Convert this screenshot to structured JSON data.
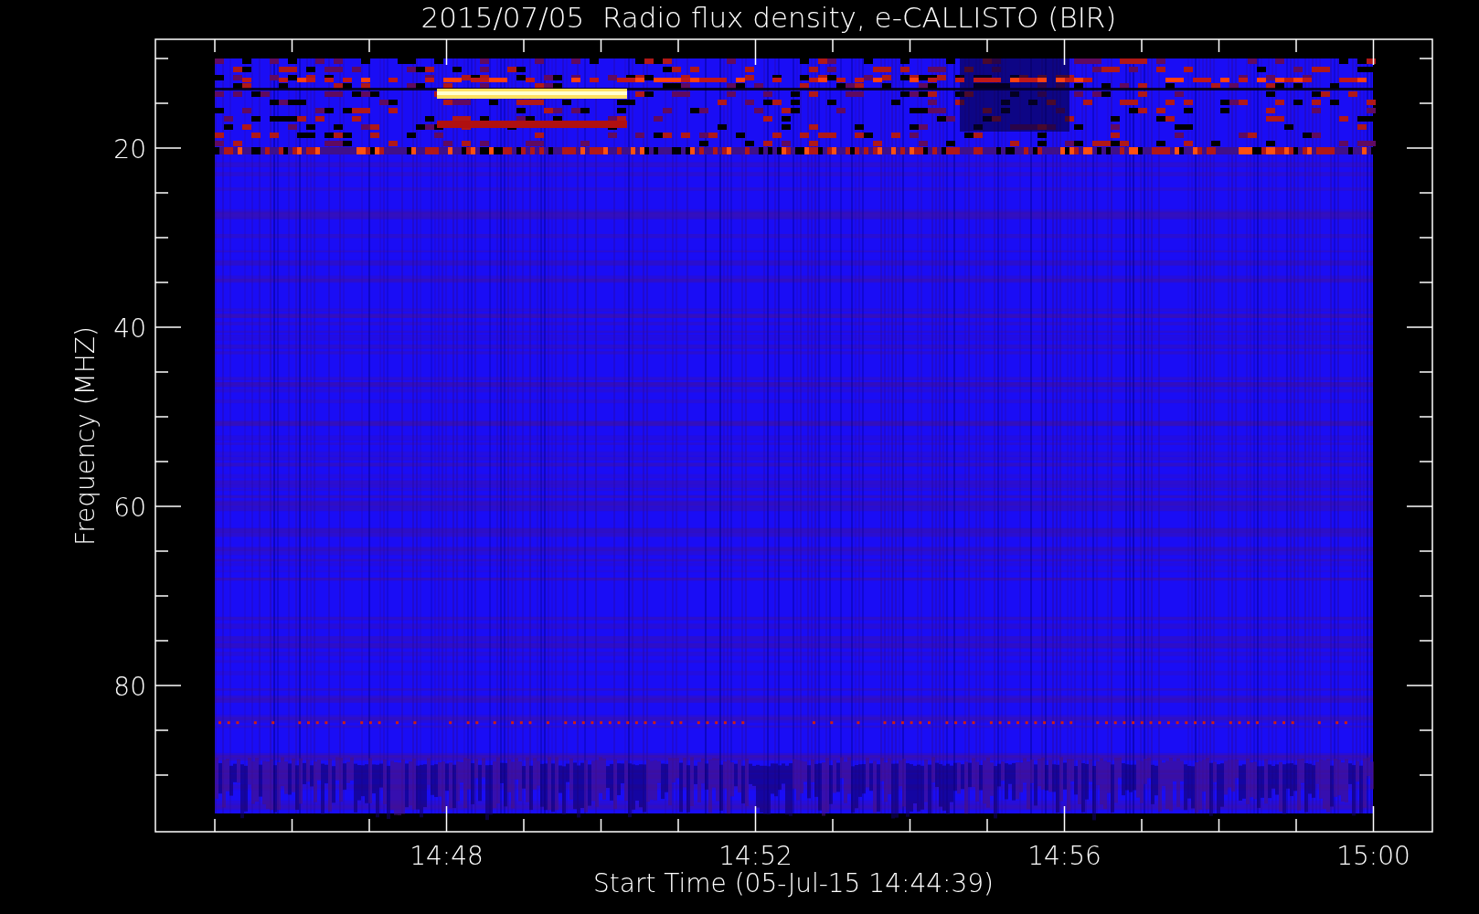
{
  "title": "2015/07/05  Radio flux density, e-CALLISTO (BIR)",
  "plot": {
    "ylabel": "Frequency (MHZ)",
    "xlabel": "Start Time (05-Jul-15 14:44:39)",
    "y_tick_labels": [
      "20",
      "40",
      "60",
      "80"
    ],
    "x_tick_labels": [
      "14:48",
      "14:52",
      "14:56",
      "15:00"
    ]
  }
}
